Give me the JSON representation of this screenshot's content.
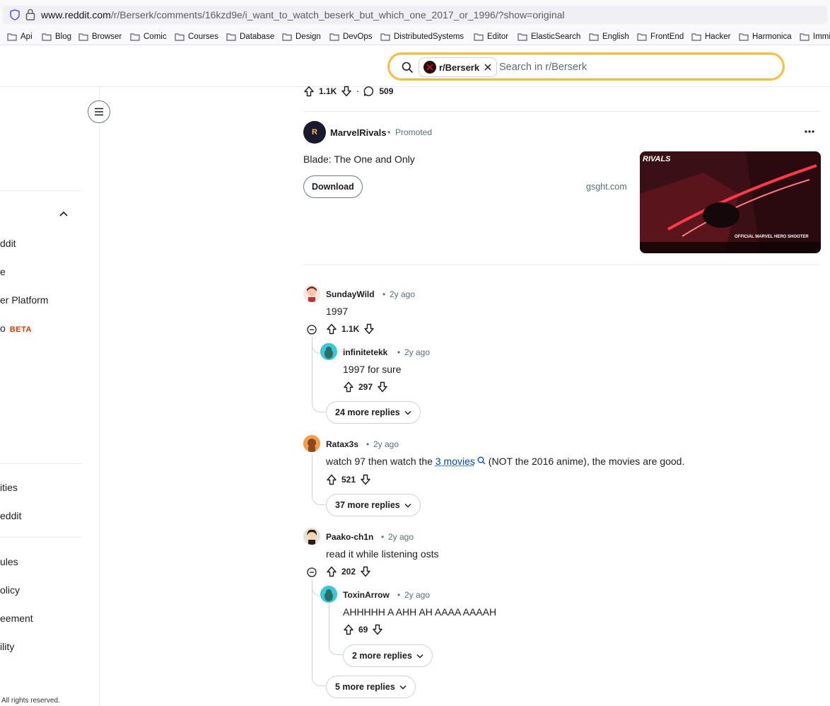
{
  "browser": {
    "url_domain": "www.reddit.com",
    "url_path": "/r/Berserk/comments/16kzd9e/i_want_to_watch_beserk_but_which_one_2017_or_1996/?show=original",
    "bookmarks": [
      "Api",
      "Blog",
      "Browser",
      "Comic",
      "Courses",
      "Database",
      "Design",
      "DevOps",
      "DistributedSystems",
      "Editor",
      "ElasticSearch",
      "English",
      "FrontEnd",
      "Hacker",
      "Harmonica",
      "Immi"
    ]
  },
  "header": {
    "search_chip": "r/Berserk",
    "search_placeholder": "Search in r/Berserk"
  },
  "sidebar": {
    "items": [
      "ddit",
      "e",
      "er Platform",
      "o"
    ],
    "beta": "BETA",
    "items2": [
      "ities",
      "eddit"
    ],
    "items3": [
      "ules",
      "olicy",
      "eement",
      "ility"
    ],
    "copyright": "All rights reserved."
  },
  "post": {
    "upvotes": "1.1K",
    "comments": "509",
    "sep": "·"
  },
  "ad": {
    "advertiser": "MarvelRivals",
    "label": "Promoted",
    "title": "Blade: The One and Only",
    "button": "Download",
    "domain": "gsght.com",
    "thumb_logo": "RIVALS",
    "thumb_caption": "OFFICIAL MARVEL HERO SHOOTER"
  },
  "comments": [
    {
      "user": "SundayWild",
      "time": "2y ago",
      "body": "1997",
      "votes": "1.1K"
    },
    {
      "user": "infinitetekk",
      "time": "2y ago",
      "body": "1997 for sure",
      "votes": "297"
    },
    {
      "more": "24 more replies"
    },
    {
      "user": "Ratax3s",
      "time": "2y ago",
      "body_pre": "watch 97 then watch the ",
      "body_link": "3 movies",
      "body_post": " (NOT the 2016 anime), the movies are good.",
      "votes": "521"
    },
    {
      "more": "37 more replies"
    },
    {
      "user": "Paako-ch1n",
      "time": "2y ago",
      "body": "read it while listening osts",
      "votes": "202"
    },
    {
      "user": "ToxinArrow",
      "time": "2y ago",
      "body": "AHHHHH A AHH AH AAAA AAAAH",
      "votes": "69"
    },
    {
      "more": "2 more replies"
    },
    {
      "more": "5 more replies"
    }
  ],
  "dot": "•",
  "colors": {
    "accent_search": "#f7c24b",
    "link": "#0045ac",
    "beta": "#d93a00"
  }
}
